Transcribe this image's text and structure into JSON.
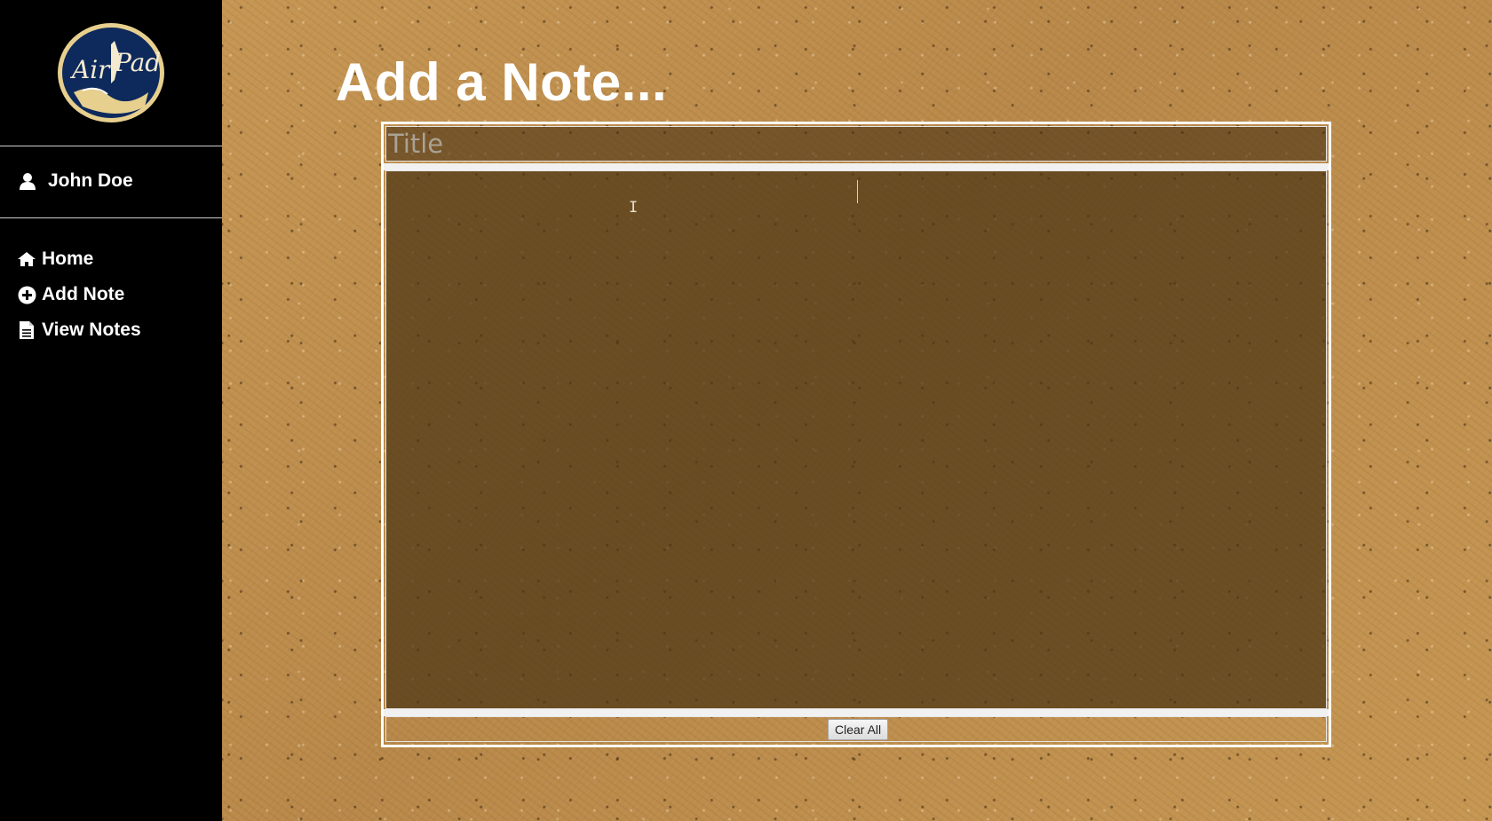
{
  "app": {
    "logo_text": "AirPad"
  },
  "sidebar": {
    "user": {
      "name": "John Doe",
      "icon": "user-icon"
    },
    "nav": [
      {
        "label": "Home",
        "icon": "home-icon"
      },
      {
        "label": "Add Note",
        "icon": "plus-circle-icon"
      },
      {
        "label": "View Notes",
        "icon": "document-icon"
      }
    ]
  },
  "main": {
    "heading": "Add a Note...",
    "form": {
      "title_placeholder": "Title",
      "title_value": "",
      "body_value": "",
      "clear_button_label": "Clear All"
    }
  },
  "colors": {
    "sidebar_bg": "#000000",
    "text": "#ffffff",
    "logo_navy": "#0e2a5c",
    "logo_gold": "#d8b56a"
  }
}
